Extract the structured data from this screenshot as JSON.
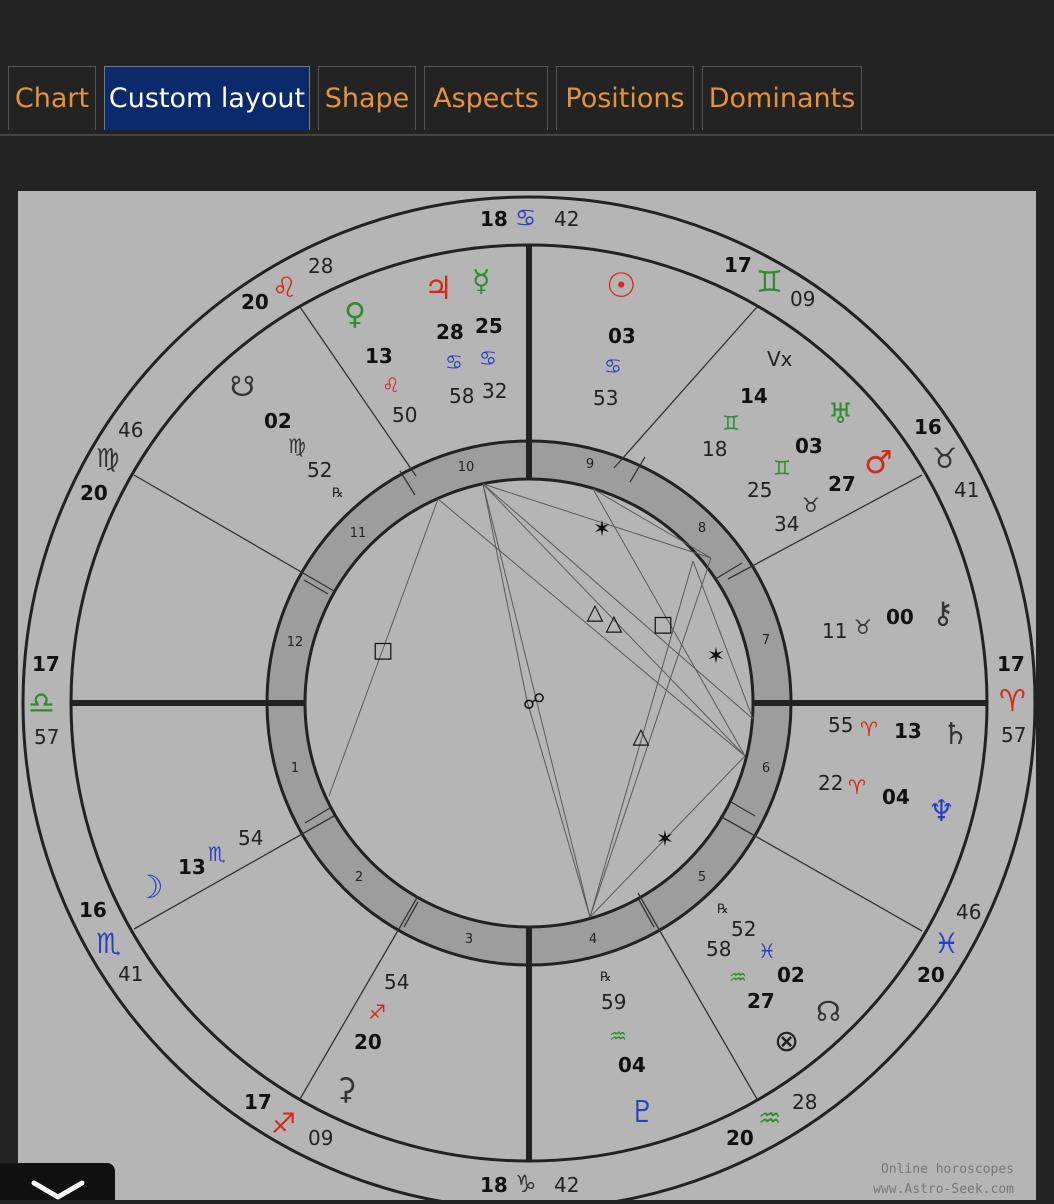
{
  "tabs": [
    {
      "label": "Chart",
      "active": false
    },
    {
      "label": "Custom layout",
      "active": true
    },
    {
      "label": "Shape",
      "active": false
    },
    {
      "label": "Aspects",
      "active": false
    },
    {
      "label": "Positions",
      "active": false
    },
    {
      "label": "Dominants",
      "active": false
    }
  ],
  "colors": {
    "tab_text": "#e6923a",
    "tab_active_bg": "#0b2a6b",
    "panel_bg": "#b5b5b5",
    "fire": "#d42a1a",
    "earth": "#2e8b2e",
    "air": "#2e8b2e",
    "water": "#2d3fbf"
  },
  "credit": {
    "line1": "Online horoscopes",
    "line2": "www.Astro-Seek.com"
  },
  "collapse_icon": "chevron-down-icon",
  "wheel": {
    "house_numbers": [
      "1",
      "2",
      "3",
      "4",
      "5",
      "6",
      "7",
      "8",
      "9",
      "10",
      "11",
      "12"
    ],
    "cusp_labels": [
      {
        "deg": "18",
        "sign": "♋",
        "sign_name": "cancer",
        "min": "42",
        "color": "#2d3fbf"
      },
      {
        "deg": "17",
        "sign": "♊",
        "sign_name": "gemini",
        "min": "09",
        "color": "#2e8b2e"
      },
      {
        "deg": "16",
        "sign": "♉",
        "sign_name": "taurus",
        "min": "41",
        "color": "#333333"
      },
      {
        "deg": "17",
        "sign": "♈",
        "sign_name": "aries",
        "min": "57",
        "color": "#d42a1a"
      },
      {
        "deg": "46",
        "sign": "♓",
        "sign_name": "pisces",
        "min": "20",
        "color": "#2d3fbf"
      },
      {
        "deg": "28",
        "sign": "♒",
        "sign_name": "aquarius",
        "min": "20",
        "color": "#2e8b2e"
      },
      {
        "deg": "18",
        "sign": "♑",
        "sign_name": "capricorn",
        "min": "42",
        "color": "#333333"
      },
      {
        "deg": "17",
        "sign": "♐",
        "sign_name": "sagittarius",
        "min": "09",
        "color": "#d42a1a"
      },
      {
        "deg": "16",
        "sign": "♏",
        "sign_name": "scorpio",
        "min": "41",
        "color": "#2d3fbf"
      },
      {
        "deg": "17",
        "sign": "♎",
        "sign_name": "libra",
        "min": "57",
        "color": "#2e8b2e"
      },
      {
        "deg": "46",
        "sign": "♍",
        "sign_name": "virgo",
        "min": "20",
        "color": "#333333"
      },
      {
        "deg": "28",
        "sign": "♌",
        "sign_name": "leo",
        "min": "20",
        "color": "#d42a1a"
      }
    ],
    "bodies": [
      {
        "name": "sun",
        "glyph": "☉",
        "deg": "03",
        "sign": "♋",
        "min": "53",
        "color": "#d42a1a",
        "sign_color": "#2d3fbf"
      },
      {
        "name": "jupiter",
        "glyph": "♃",
        "deg": "28",
        "sign": "♋",
        "min": "58",
        "color": "#d42a1a",
        "sign_color": "#2d3fbf"
      },
      {
        "name": "mercury",
        "glyph": "☿",
        "deg": "25",
        "sign": "♋",
        "min": "32",
        "color": "#2e8b2e",
        "sign_color": "#2d3fbf"
      },
      {
        "name": "venus",
        "glyph": "♀",
        "deg": "13",
        "sign": "♌",
        "min": "50",
        "color": "#2e8b2e",
        "sign_color": "#d42a1a"
      },
      {
        "name": "south-node",
        "glyph": "☋",
        "deg": "02",
        "sign": "♍",
        "min": "52",
        "retro": "℞",
        "color": "#333333",
        "sign_color": "#333333"
      },
      {
        "name": "vertex",
        "glyph": "Vx",
        "deg": "",
        "sign": "",
        "min": "",
        "color": "#333333",
        "sign_color": "#333333"
      },
      {
        "name": "uranus",
        "glyph": "♅",
        "deg": "14",
        "sign": "♊",
        "min": "18",
        "color": "#2e8b2e",
        "sign_color": "#2e8b2e"
      },
      {
        "name": "mars",
        "glyph": "♂",
        "deg": "03",
        "sign": "♊",
        "min": "25",
        "color": "#d42a1a",
        "sign_color": "#2e8b2e"
      },
      {
        "name": "lilith",
        "glyph": "",
        "deg": "27",
        "sign": "♉",
        "min": "34",
        "color": "#333333",
        "sign_color": "#333333"
      },
      {
        "name": "chiron",
        "glyph": "⚷",
        "deg": "00",
        "sign": "♉",
        "min": "11",
        "color": "#333333",
        "sign_color": "#333333"
      },
      {
        "name": "saturn",
        "glyph": "♄",
        "deg": "13",
        "sign": "♈",
        "min": "55",
        "color": "#333333",
        "sign_color": "#d42a1a"
      },
      {
        "name": "neptune",
        "glyph": "♆",
        "deg": "04",
        "sign": "♈",
        "min": "22",
        "color": "#2d3fbf",
        "sign_color": "#d42a1a"
      },
      {
        "name": "north-node",
        "glyph": "☊",
        "deg": "02",
        "sign": "♓",
        "min": "52",
        "retro": "℞",
        "color": "#333333",
        "sign_color": "#2d3fbf"
      },
      {
        "name": "fortune",
        "glyph": "⊗",
        "deg": "27",
        "sign": "♒",
        "min": "58",
        "color": "#333333",
        "sign_color": "#2e8b2e"
      },
      {
        "name": "pluto",
        "glyph": "♇",
        "deg": "04",
        "sign": "♒",
        "min": "59",
        "retro": "℞",
        "color": "#2d3fbf",
        "sign_color": "#2e8b2e"
      },
      {
        "name": "moon",
        "glyph": "☽",
        "deg": "13",
        "sign": "♏",
        "min": "54",
        "color": "#2d3fbf",
        "sign_color": "#2d3fbf"
      },
      {
        "name": "ceres",
        "glyph": "⚳",
        "deg": "20",
        "sign": "♐",
        "min": "54",
        "color": "#333333",
        "sign_color": "#d42a1a"
      }
    ],
    "aspect_symbols": [
      {
        "name": "sextile",
        "glyph": "✶"
      },
      {
        "name": "trine",
        "glyph": "△"
      },
      {
        "name": "square",
        "glyph": "□"
      },
      {
        "name": "opposition",
        "glyph": "☍"
      }
    ]
  }
}
